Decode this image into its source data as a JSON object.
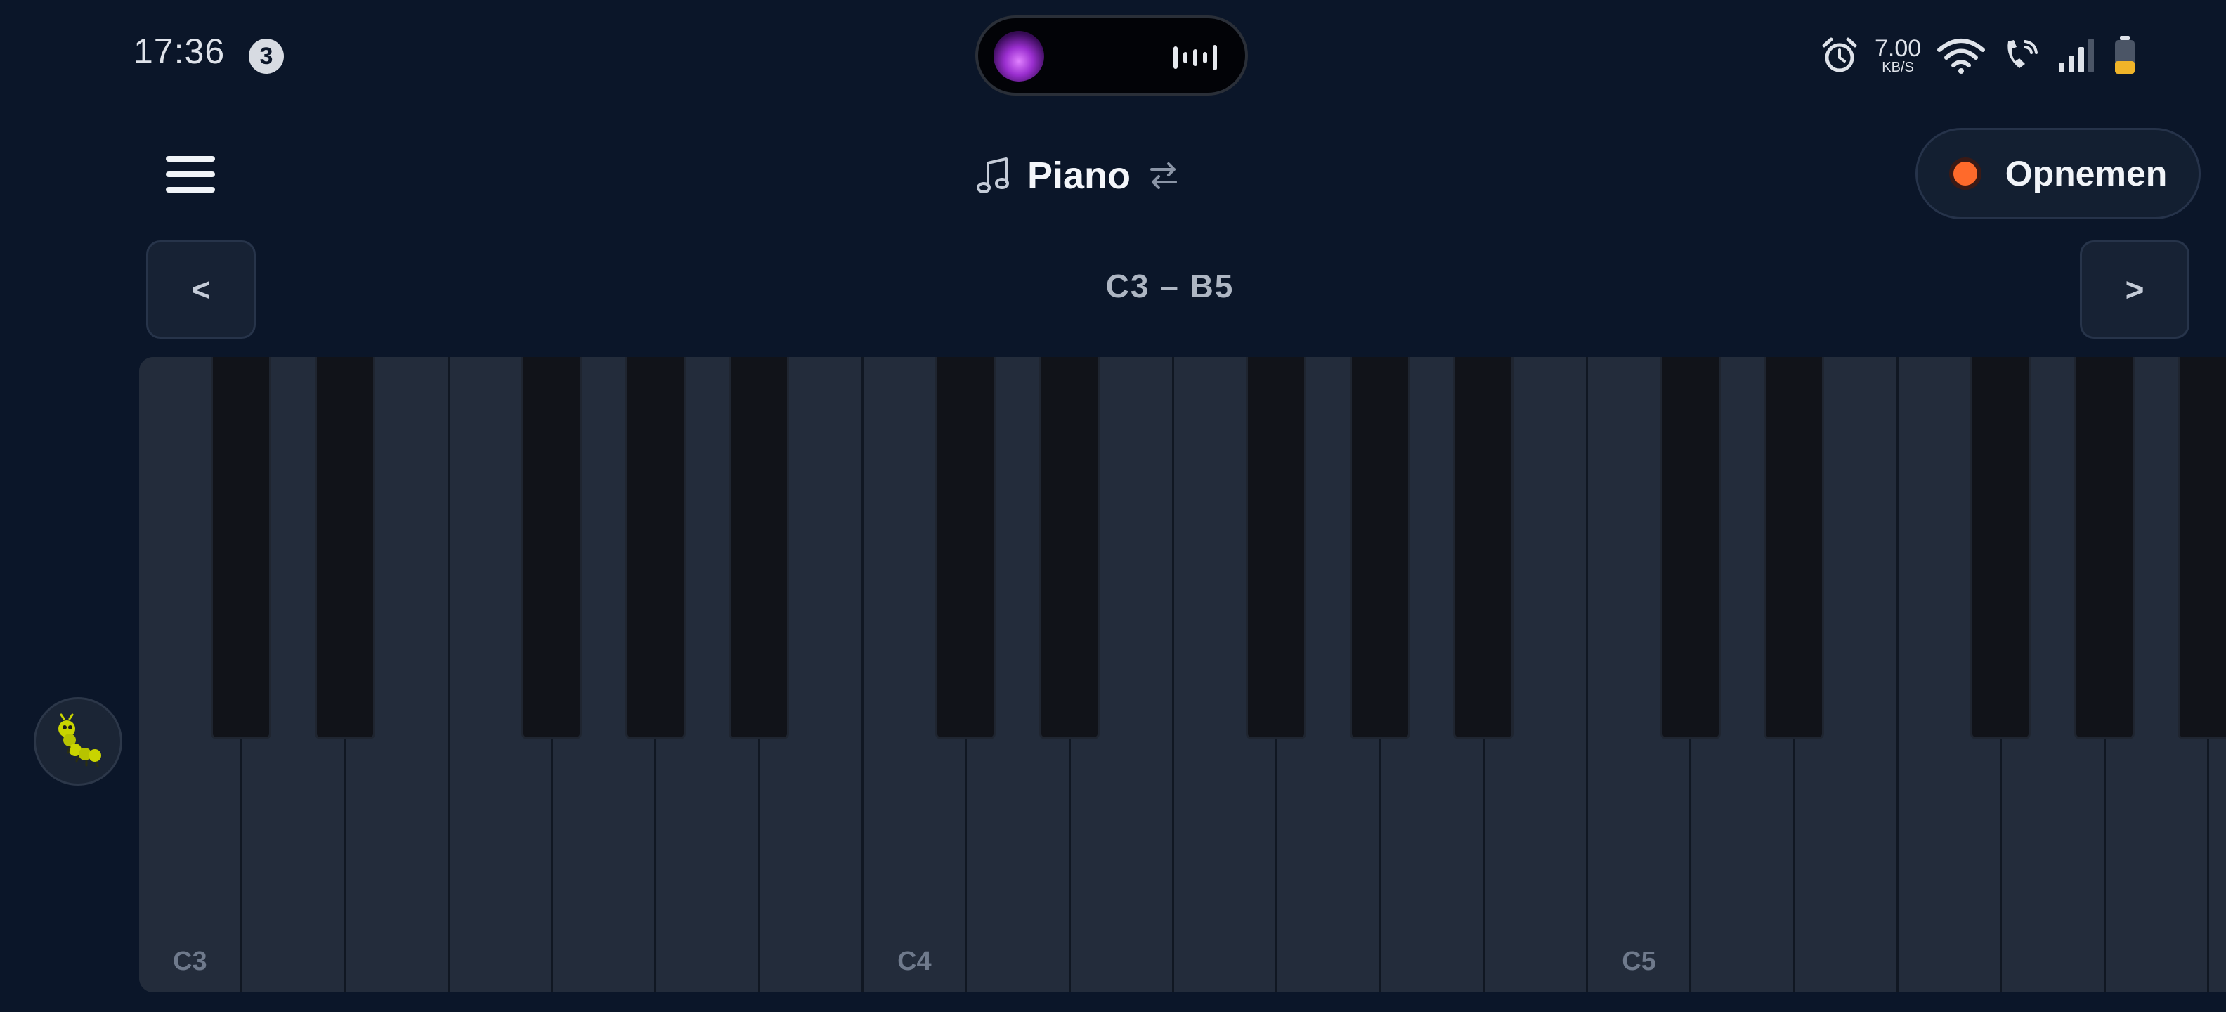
{
  "status_bar": {
    "time": "17:36",
    "notification_count": "3",
    "net_speed_value": "7.00",
    "net_speed_unit": "KB/S",
    "icons": [
      "alarm-icon",
      "wifi-icon",
      "wifi-call-icon",
      "signal-icon",
      "battery-icon"
    ],
    "media_island": {
      "art": "album-art",
      "indicator": "audio-waveform-icon"
    }
  },
  "header": {
    "menu_icon": "hamburger-menu-icon",
    "instrument_icon": "music-note-icon",
    "instrument": "Piano",
    "switch_icon": "swap-arrows-icon",
    "record_label": "Opnemen",
    "record_color": "#ff6a2b"
  },
  "octave_nav": {
    "prev_label": "<",
    "next_label": ">",
    "range": "C3 – B5"
  },
  "side": {
    "bug_icon": "caterpillar-icon"
  },
  "keyboard": {
    "white_keys": [
      {
        "note": "C3",
        "label": "C3"
      },
      {
        "note": "D3",
        "label": ""
      },
      {
        "note": "E3",
        "label": ""
      },
      {
        "note": "F3",
        "label": ""
      },
      {
        "note": "G3",
        "label": ""
      },
      {
        "note": "A3",
        "label": ""
      },
      {
        "note": "B3",
        "label": ""
      },
      {
        "note": "C4",
        "label": "C4"
      },
      {
        "note": "D4",
        "label": ""
      },
      {
        "note": "E4",
        "label": ""
      },
      {
        "note": "F4",
        "label": ""
      },
      {
        "note": "G4",
        "label": ""
      },
      {
        "note": "A4",
        "label": ""
      },
      {
        "note": "B4",
        "label": ""
      },
      {
        "note": "C5",
        "label": "C5"
      },
      {
        "note": "D5",
        "label": ""
      },
      {
        "note": "E5",
        "label": ""
      },
      {
        "note": "F5",
        "label": ""
      },
      {
        "note": "G5",
        "label": ""
      },
      {
        "note": "A5",
        "label": ""
      },
      {
        "note": "B5",
        "label": ""
      }
    ],
    "black_keys": [
      "C#3",
      "D#3",
      "F#3",
      "G#3",
      "A#3",
      "C#4",
      "D#4",
      "F#4",
      "G#4",
      "A#4",
      "C#5",
      "D#5",
      "F#5",
      "G#5",
      "A#5"
    ],
    "colors": {
      "white_key": "#232c3b",
      "black_key": "#111319",
      "background": "#0b1629"
    }
  }
}
